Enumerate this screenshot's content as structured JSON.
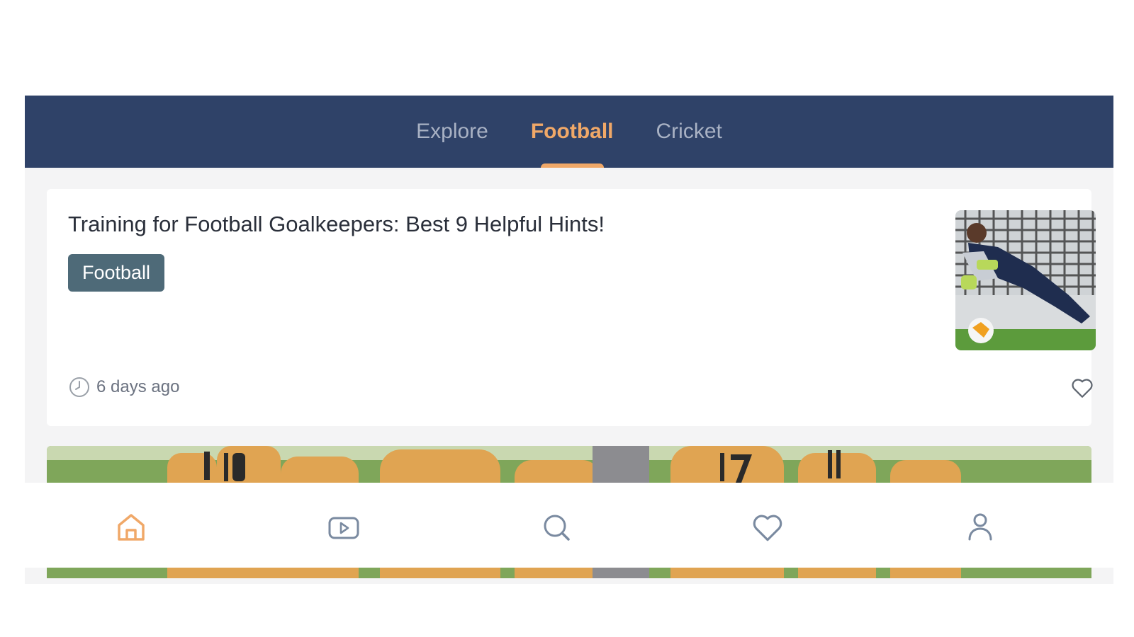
{
  "tabs": [
    {
      "label": "Explore",
      "active": false
    },
    {
      "label": "Football",
      "active": true
    },
    {
      "label": "Cricket",
      "active": false
    }
  ],
  "article": {
    "title": "Training for Football Goalkeepers: Best 9 Helpful Hints!",
    "tag": "Football",
    "time": "6 days ago",
    "thumbnail_icon": "goalkeeper-photo",
    "favorite_icon": "heart-icon"
  },
  "next_article": {
    "image_icon": "team-photo"
  },
  "bottom_nav": [
    {
      "name": "home",
      "icon": "home-icon",
      "active": true
    },
    {
      "name": "videos",
      "icon": "play-icon",
      "active": false
    },
    {
      "name": "search",
      "icon": "search-icon",
      "active": false
    },
    {
      "name": "favorites",
      "icon": "heart-icon",
      "active": false
    },
    {
      "name": "profile",
      "icon": "user-icon",
      "active": false
    }
  ],
  "colors": {
    "header_bg": "#2f4268",
    "accent": "#f0a868",
    "tag_bg": "#4e6a78",
    "inactive_icon": "#7a8aa0"
  }
}
